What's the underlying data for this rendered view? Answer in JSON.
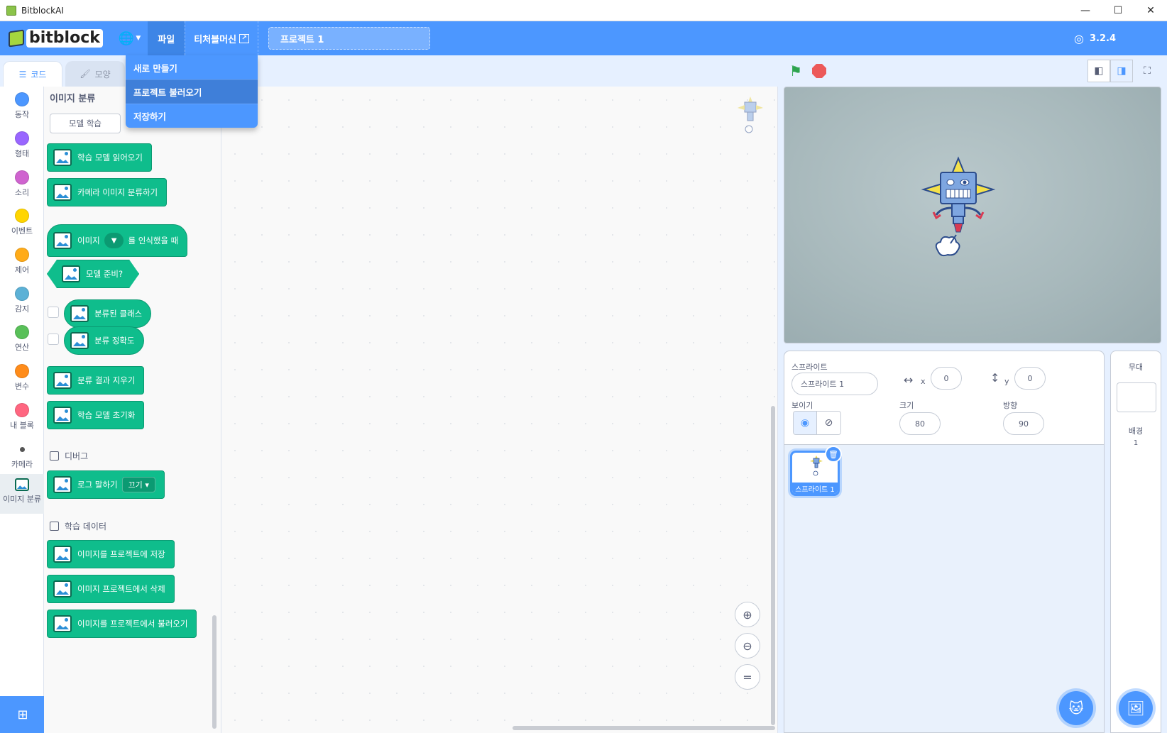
{
  "window": {
    "title": "BitblockAI",
    "minimize": "—",
    "maximize": "☐",
    "close": "✕"
  },
  "menubar": {
    "logo_text": "bitblock",
    "file_menu": "파일",
    "teacher_menu": "티처블머신",
    "project_title": "프로젝트 1",
    "version": "3.2.4"
  },
  "file_dropdown": {
    "items": [
      {
        "label": "새로 만들기",
        "active": false
      },
      {
        "label": "프로젝트 불러오기",
        "active": true
      },
      {
        "label": "저장하기",
        "active": false
      }
    ]
  },
  "tabs": {
    "code": "코드",
    "costume": "모양"
  },
  "categories": [
    {
      "label": "동작",
      "color": "#4c97ff"
    },
    {
      "label": "형태",
      "color": "#9966ff"
    },
    {
      "label": "소리",
      "color": "#cf63cf"
    },
    {
      "label": "이벤트",
      "color": "#ffd500"
    },
    {
      "label": "제어",
      "color": "#ffab19"
    },
    {
      "label": "감지",
      "color": "#5cb1d6"
    },
    {
      "label": "연산",
      "color": "#59c059"
    },
    {
      "label": "변수",
      "color": "#ff8c1a"
    },
    {
      "label": "내 블록",
      "color": "#ff6680"
    },
    {
      "label": "카메라",
      "color": "#555555"
    },
    {
      "label": "이미지 분류",
      "color": "#0fbd8c"
    }
  ],
  "palette": {
    "title": "이미지 분류",
    "train_button": "모델 학습",
    "blocks": {
      "load_model": "학습 모델 읽어오기",
      "classify_camera": "카메라 이미지 분류하기",
      "when_recognized_a": "이미지",
      "when_recognized_b": "를 인식했을 때",
      "model_ready": "모델 준비?",
      "classified_class": "분류된 클래스",
      "accuracy": "분류 정확도",
      "clear_result": "분류 결과 지우기",
      "reset_model": "학습 모델 초기화",
      "log_say": "로그 말하기",
      "log_option": "끄기",
      "save_images": "이미지를 프로젝트에 저장",
      "delete_images": "이미지 프로젝트에서 삭제",
      "load_images": "이미지를 프로젝트에서 불러오기"
    },
    "section_debug": "디버그",
    "section_data": "학습 데이터"
  },
  "sprite_info": {
    "sprite_label": "스프라이트",
    "sprite_name": "스프라이트 1",
    "x_label": "x",
    "x": "0",
    "y_label": "y",
    "y": "0",
    "show_label": "보이기",
    "size_label": "크기",
    "size": "80",
    "direction_label": "방향",
    "direction": "90"
  },
  "sprite_list": [
    {
      "name": "스프라이트 1",
      "selected": true
    }
  ],
  "stage_pane": {
    "label": "무대",
    "backdrops_label": "배경",
    "backdrops_count": "1"
  }
}
